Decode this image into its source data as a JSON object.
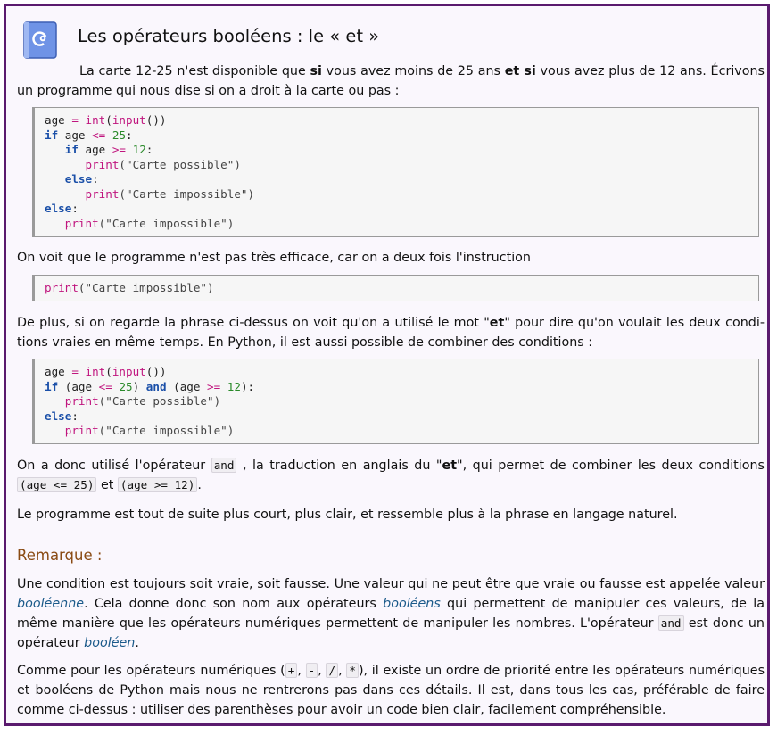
{
  "title": "Les opérateurs booléens : le « et »",
  "intro": {
    "part1": "La carte 12-25 n'est disponible que ",
    "bold1": "si",
    "part2": " vous avez moins de 25 ans ",
    "bold2": "et si",
    "part3": " vous avez plus de 12 ans. Écrivons un programme qui nous dise si on a droit à la carte ou pas :"
  },
  "code1": {
    "l1": [
      "age",
      " = ",
      "int",
      "(",
      "input",
      "())"
    ],
    "l2": [
      "if",
      " age ",
      "<=",
      " ",
      "25",
      ":"
    ],
    "l3": [
      "   ",
      "if",
      " age ",
      ">=",
      " ",
      "12",
      ":"
    ],
    "l4": [
      "      ",
      "print",
      "(\"Carte possible\")"
    ],
    "l5": [
      "   ",
      "else",
      ":"
    ],
    "l6": [
      "      ",
      "print",
      "(\"Carte impossible\")"
    ],
    "l7": [
      "else",
      ":"
    ],
    "l8": [
      "   ",
      "print",
      "(\"Carte impossible\")"
    ]
  },
  "para2": "On voit que le programme n'est pas très efficace, car on a deux fois l'instruction",
  "code2": [
    "print",
    "(\"Carte impossible\")"
  ],
  "para3": {
    "a": "De plus, si on regarde la phrase ci-dessus on voit qu'on a utilisé le mot \"",
    "b": "et",
    "c": "\" pour dire qu'on voulait les deux condi­tions vraies en même temps. En Python, il est aussi possible de combiner des conditions :"
  },
  "code3": {
    "l1": [
      "age",
      " = ",
      "int",
      "(",
      "input",
      "())"
    ],
    "l2": [
      "if",
      " (age ",
      "<=",
      " ",
      "25",
      ") ",
      "and",
      " (age ",
      ">=",
      " ",
      "12",
      "):"
    ],
    "l3": [
      "   ",
      "print",
      "(\"Carte possible\")"
    ],
    "l4": [
      "else",
      ":"
    ],
    "l5": [
      "   ",
      "print",
      "(\"Carte impossible\")"
    ]
  },
  "para4": {
    "a": "On a donc utilisé l'opérateur ",
    "code_and": "and",
    "b": " , la traduction en anglais du \"",
    "c": "et",
    "d": "\", qui permet de combiner les deux conditions ",
    "cond1": "(age <= 25)",
    "e": " et ",
    "cond2": "(age >= 12)",
    "f": "."
  },
  "para5": "Le programme est tout de suite plus court, plus clair, et ressemble plus à la phrase en langage naturel.",
  "remarque_title": "Remarque :",
  "para6": {
    "a": "Une condition est toujours soit vraie, soit fausse. Une valeur qui ne peut être que vraie ou fausse est appelée valeur ",
    "t1": "booléenne",
    "b": ". Cela donne donc son nom aux opérateurs ",
    "t2": "booléens",
    "c": " qui permettent de manipuler ces valeurs, de la même manière que les opérateurs numériques permettent de manipuler les nombres. L'opérateur ",
    "code_and": "and",
    "d": " est donc un opéra­teur ",
    "t3": "booléen",
    "e": "."
  },
  "para7": {
    "a": "Comme pour les opérateurs numériques (",
    "o1": "+",
    "s1": ", ",
    "o2": "-",
    "s2": ", ",
    "o3": "/",
    "s3": ", ",
    "o4": "*",
    "b": "), il existe un ordre de priorité entre les opérateurs numériques et booléens de Python mais nous ne rentrerons pas dans ces détails. Il est, dans tous les cas, préférable de faire comme ci-dessus : utiliser des parenthèses pour avoir un code bien clair, facilement compréhensible."
  },
  "colors": {
    "frame": "#5a1a6e",
    "keyword": "#1a4fa8",
    "builtin": "#c0157e",
    "number": "#2a8a2a",
    "remarque": "#8a4b14",
    "term": "#1b5a8a"
  },
  "icon": "notebook-icon"
}
